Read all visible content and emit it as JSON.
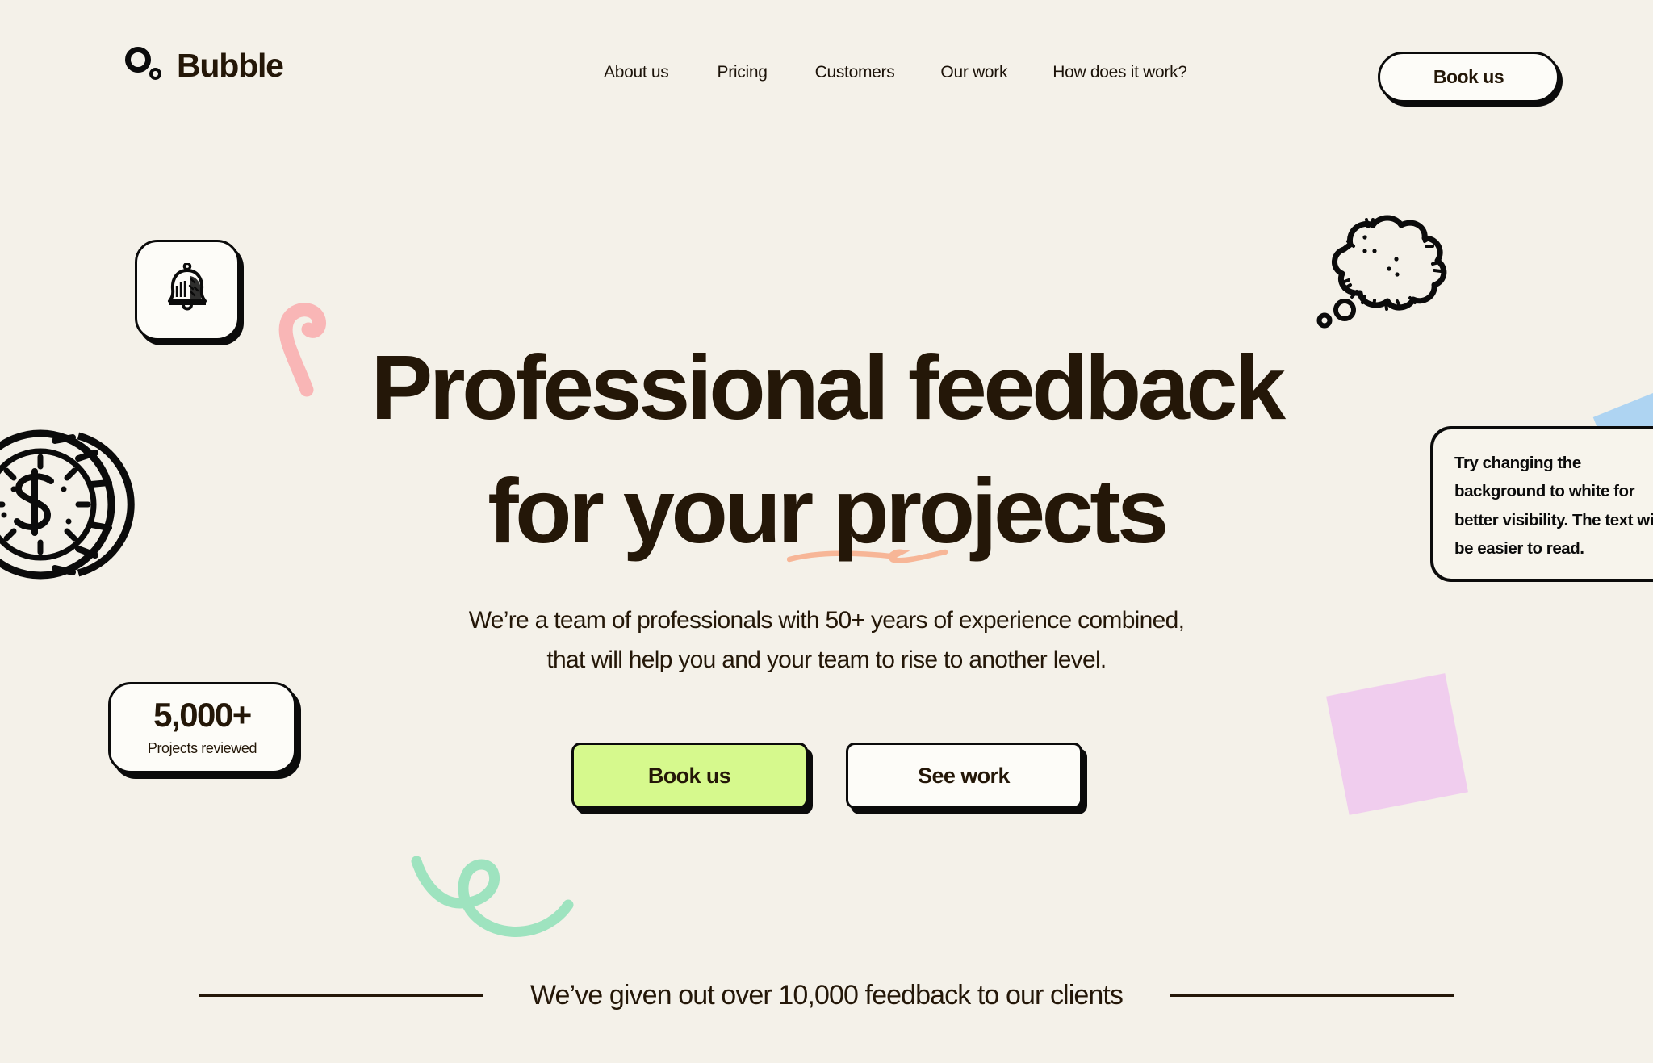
{
  "brand": {
    "name": "Bubble",
    "logo_icon": "bubble-circles-icon"
  },
  "nav": {
    "items": [
      {
        "label": "About us"
      },
      {
        "label": "Pricing"
      },
      {
        "label": "Customers"
      },
      {
        "label": "Our work"
      },
      {
        "label": "How does it work?"
      }
    ],
    "cta_label": "Book us"
  },
  "hero": {
    "headline_line1": "Professional feedback",
    "headline_line2": "for your projects",
    "subhead_line1": "We’re a team of professionals with 50+ years of experience combined,",
    "subhead_line2": "that will help you and your team to rise to another level.",
    "primary_cta": "Book us",
    "secondary_cta": "See work"
  },
  "stat_card": {
    "value": "5,000+",
    "label": "Projects reviewed"
  },
  "bell_card": {
    "icon": "bell-icon"
  },
  "callout": {
    "text": "Try changing the background to white for better visibility. The text will be easier to read."
  },
  "footer": {
    "text": "We’ve given out over 10,000 feedback to our clients"
  },
  "decor": {
    "coin_icon": "dollar-coin-icon",
    "thought_bubble_icon": "thought-bubble-icon",
    "pink_hook_icon": "pink-hook-squiggle",
    "orange_underline_icon": "orange-underline-squiggle",
    "green_swirl_icon": "green-loop-squiggle",
    "purple_square_icon": "purple-rotated-square",
    "blue_shape_icon": "blue-corner-shape"
  },
  "colors": {
    "background": "#f4f1e9",
    "ink": "#241708",
    "black": "#0b0b0b",
    "card": "#fdfcf8",
    "accent_green": "#d6f98d",
    "pink": "#f9b6b6",
    "orange": "#f7b697",
    "mint": "#9ee3bf",
    "lavender": "#f0cdee",
    "blue": "#aed4f2"
  }
}
